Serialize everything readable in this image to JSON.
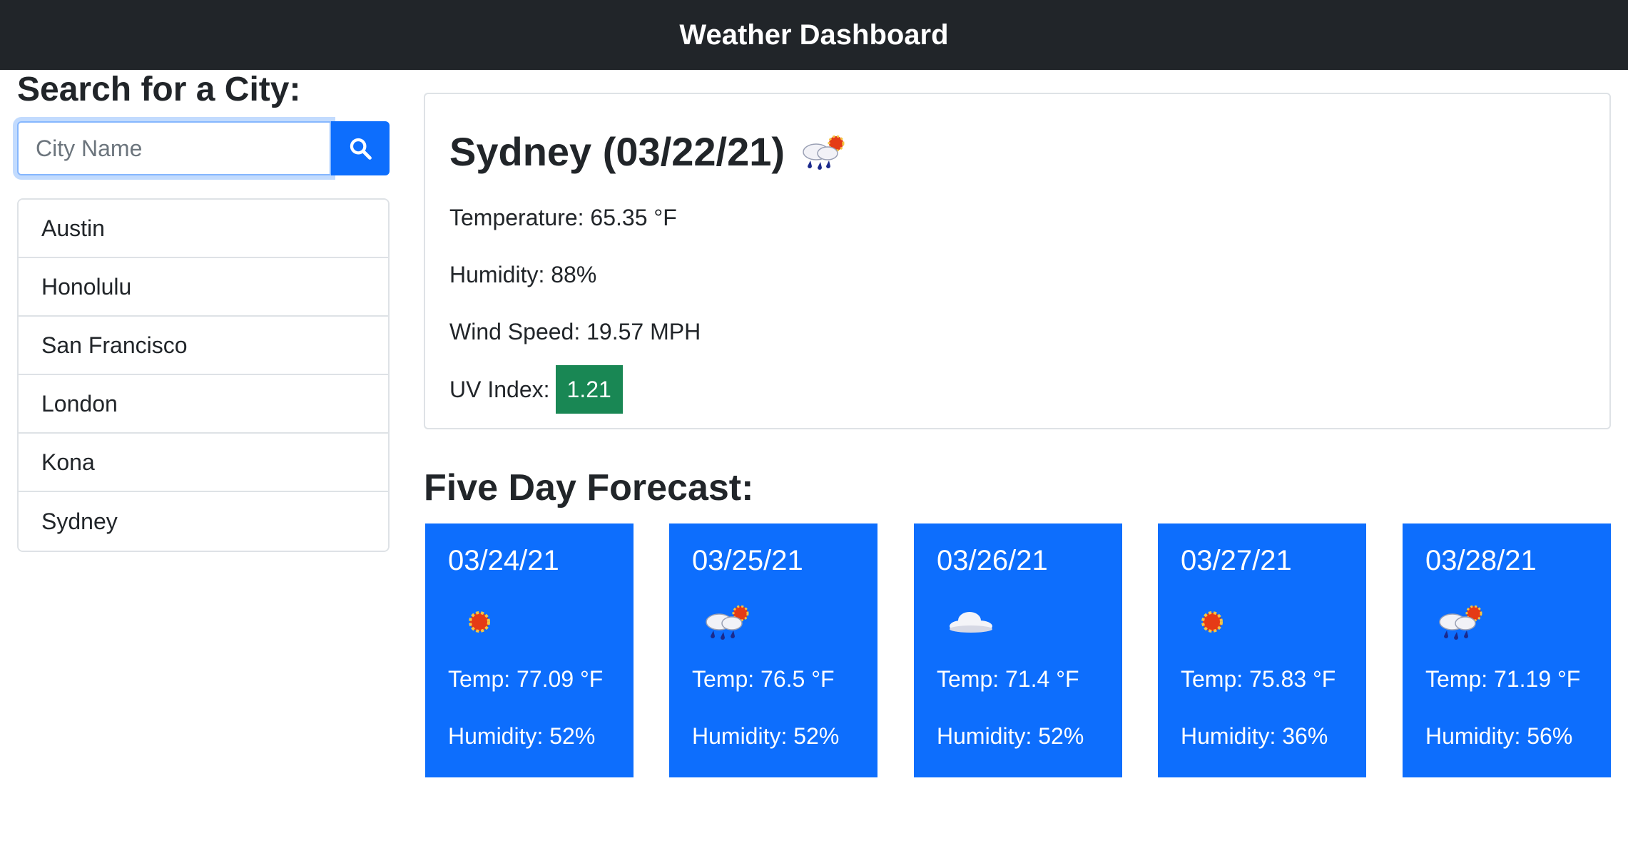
{
  "navbar": {
    "title": "Weather Dashboard"
  },
  "search": {
    "heading": "Search for a City:",
    "placeholder": "City Name",
    "button_icon": "search-icon"
  },
  "history": {
    "cities": [
      "Austin",
      "Honolulu",
      "San Francisco",
      "London",
      "Kona",
      "Sydney"
    ]
  },
  "current": {
    "title": "Sydney (03/22/21)",
    "icon": "rain-sun-cloud-icon",
    "temperature": "Temperature: 65.35 °F",
    "humidity": "Humidity: 88%",
    "wind": "Wind Speed: 19.57 MPH",
    "uv_label": "UV Index:",
    "uv_value": "1.21",
    "uv_color": "#198754"
  },
  "forecast": {
    "heading": "Five Day Forecast:",
    "days": [
      {
        "date": "03/24/21",
        "icon": "sun-icon",
        "temp": "Temp: 77.09 °F",
        "humidity": "Humidity: 52%"
      },
      {
        "date": "03/25/21",
        "icon": "rain-sun-cloud-icon",
        "temp": "Temp: 76.5 °F",
        "humidity": "Humidity: 52%"
      },
      {
        "date": "03/26/21",
        "icon": "cloud-icon",
        "temp": "Temp: 71.4 °F",
        "humidity": "Humidity: 52%"
      },
      {
        "date": "03/27/21",
        "icon": "sun-icon",
        "temp": "Temp: 75.83 °F",
        "humidity": "Humidity: 36%"
      },
      {
        "date": "03/28/21",
        "icon": "rain-sun-cloud-icon",
        "temp": "Temp: 71.19 °F",
        "humidity": "Humidity: 56%"
      }
    ]
  },
  "colors": {
    "navbar_bg": "#212529",
    "primary": "#0d6efd",
    "uv_low": "#198754"
  }
}
